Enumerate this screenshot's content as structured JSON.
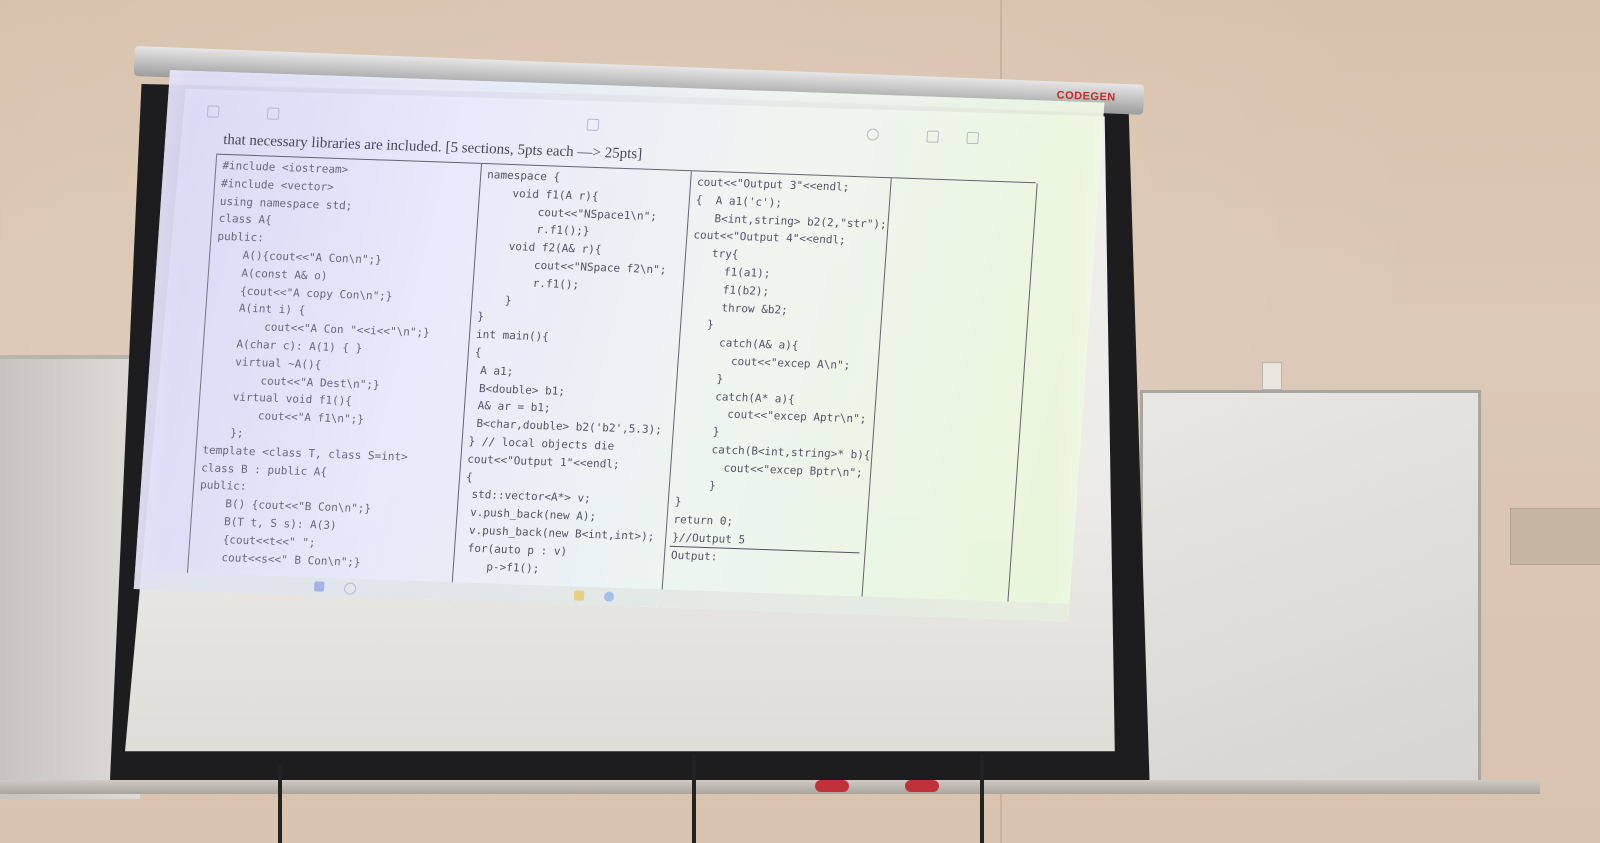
{
  "projector_screen": {
    "brand": "CODEGEN"
  },
  "slide": {
    "intro_text": "that necessary libraries are included. [5 sections, 5pts each —> 25pts]",
    "columns": [
      {
        "lines": [
          "#include <iostream>",
          "#include <vector>",
          "using namespace std;",
          "class A{",
          "public:",
          "    A(){cout<<\"A Con\\n\";}",
          "    A(const A& o)",
          "    {cout<<\"A copy Con\\n\";}",
          "    A(int i) {",
          "        cout<<\"A Con \"<<i<<\"\\n\";}",
          "    A(char c): A(1) { }",
          "    virtual ~A(){",
          "        cout<<\"A Dest\\n\";}",
          "    virtual void f1(){",
          "        cout<<\"A f1\\n\";}",
          "    };",
          "template <class T, class S=int>",
          "class B : public A{",
          "public:",
          "    B() {cout<<\"B Con\\n\";}",
          "    B(T t, S s): A(3)",
          "    {cout<<t<<\" \";",
          "    cout<<s<<\" B Con\\n\";}"
        ]
      },
      {
        "lines": [
          "namespace {",
          "    void f1(A r){",
          "        cout<<\"NSpace1\\n\";",
          "        r.f1();}",
          "    void f2(A& r){",
          "        cout<<\"NSpace f2\\n\";",
          "        r.f1();",
          "    }",
          "}",
          "int main(){",
          "{",
          " A a1;",
          " B<double> b1;",
          " A& ar = b1;",
          " B<char,double> b2('b2',5.3);",
          "} // local objects die",
          "cout<<\"Output 1\"<<endl;",
          "{",
          " std::vector<A*> v;",
          " v.push_back(new A);",
          " v.push_back(new B<int,int>);",
          " for(auto p : v)",
          "    p->f1();"
        ]
      },
      {
        "lines": [
          "cout<<\"Output 3\"<<endl;",
          "{  A a1('c');",
          "   B<int,string> b2(2,\"str\");",
          "cout<<\"Output 4\"<<endl;",
          "   try{",
          "     f1(a1);",
          "     f1(b2);",
          "     throw &b2;",
          "   }",
          "     catch(A& a){",
          "       cout<<\"excep A\\n\";",
          "     }",
          "     catch(A* a){",
          "       cout<<\"excep Aptr\\n\";",
          "     }",
          "     catch(B<int,string>* b){",
          "       cout<<\"excep Bptr\\n\";",
          "     }",
          "}",
          "return 0;",
          "}//Output 5",
          "Output:"
        ]
      }
    ]
  },
  "icons": {
    "taskbar": [
      "windows-start-icon",
      "search-icon",
      "file-explorer-icon",
      "browser-icon"
    ]
  }
}
